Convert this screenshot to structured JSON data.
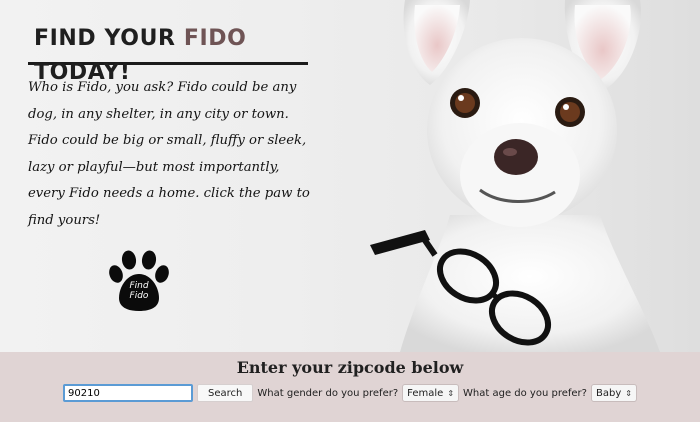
{
  "hero": {
    "title_prefix": "Find your",
    "title_accent": "Fido",
    "title_suffix": "today!",
    "blurb": "Who is Fido, you ask? Fido could be any dog, in any shelter, in any city or town. Fido could be big or small, fluffy or sleek, lazy or playful—but most importantly, every Fido needs a home. click the paw to find yours!",
    "paw_label_line1": "Find",
    "paw_label_line2": "Fido"
  },
  "search": {
    "heading": "Enter your zipcode below",
    "zip_value": "90210",
    "search_label": "Search",
    "gender_label": "What gender do you prefer?",
    "gender_value": "Female",
    "age_label": "What age do you prefer?",
    "age_value": "Baby"
  },
  "colors": {
    "accent": "#6f5455",
    "search_bar_bg": "#e0d4d4",
    "input_focus": "#5b9bd5"
  },
  "icons": [
    "paw-icon",
    "chevron-updown-icon"
  ]
}
